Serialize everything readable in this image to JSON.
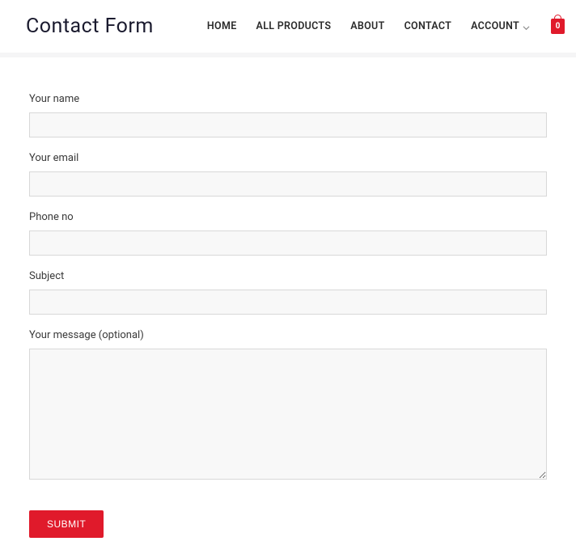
{
  "header": {
    "title": "Contact Form"
  },
  "nav": {
    "items": [
      {
        "label": "HOME"
      },
      {
        "label": "ALL PRODUCTS"
      },
      {
        "label": "ABOUT"
      },
      {
        "label": "CONTACT"
      },
      {
        "label": "ACCOUNT",
        "dropdown": true
      }
    ]
  },
  "cart": {
    "count": "0"
  },
  "form": {
    "fields": {
      "name": {
        "label": "Your name",
        "value": ""
      },
      "email": {
        "label": "Your email",
        "value": ""
      },
      "phone": {
        "label": "Phone no",
        "value": ""
      },
      "subject": {
        "label": "Subject",
        "value": ""
      },
      "message": {
        "label": "Your message (optional)",
        "value": ""
      }
    },
    "submit_label": "SUBMIT"
  }
}
